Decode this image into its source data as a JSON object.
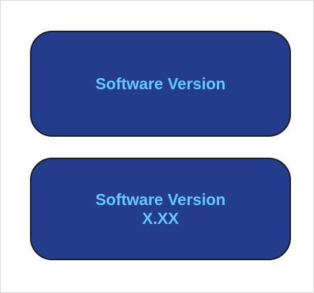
{
  "panels": {
    "top": {
      "label": "Software Version"
    },
    "bottom": {
      "label": "Software Version",
      "value": "X.XX"
    }
  },
  "colors": {
    "panel_fill": "#233d8c",
    "panel_border": "#1b1b1b",
    "label_text": "#67c8ff",
    "background": "#ffffff"
  }
}
